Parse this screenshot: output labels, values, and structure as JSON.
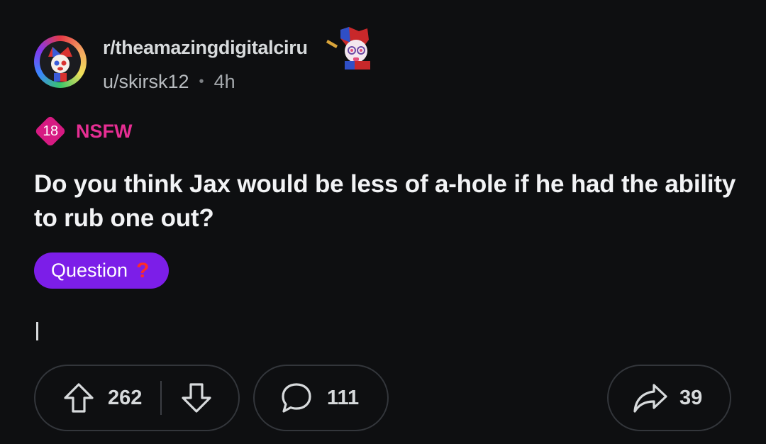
{
  "post": {
    "subreddit": "r/theamazingdigitalciru",
    "author": "u/skirsk12",
    "separator": "•",
    "time": "4h",
    "nsfw_badge": "18",
    "nsfw_label": "NSFW",
    "title": "Do you think Jax would be less of a-hole if he had the ability to rub one out?",
    "flair": {
      "text": "Question",
      "emoji": "?"
    }
  },
  "actions": {
    "upvotes": "262",
    "comments": "111",
    "shares": "39"
  },
  "icons": {
    "avatar": "subreddit-avatar",
    "upvote": "arrow-up-icon",
    "downvote": "arrow-down-icon",
    "comment": "speech-bubble-icon",
    "share": "share-arrow-icon"
  },
  "colors": {
    "background": "#0e0f11",
    "nsfw": "#d61a82",
    "flair": "#7c1ee8",
    "flair_emoji": "#ff2a2a"
  }
}
